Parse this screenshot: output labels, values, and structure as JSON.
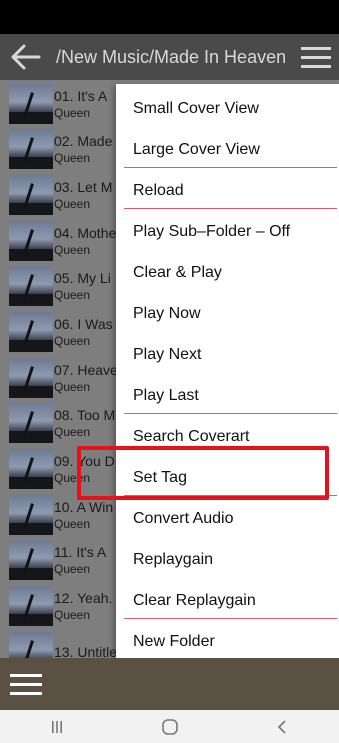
{
  "header": {
    "title": "/New Music/Made In Heaven"
  },
  "tracks": [
    {
      "title": "01. It's A",
      "artist": "Queen"
    },
    {
      "title": "02. Made",
      "artist": "Queen"
    },
    {
      "title": "03. Let M",
      "artist": "Queen"
    },
    {
      "title": "04. Mothe",
      "artist": "Queen"
    },
    {
      "title": "05. My Li",
      "artist": "Queen"
    },
    {
      "title": "06. I Was",
      "artist": "Queen"
    },
    {
      "title": "07. Heave",
      "artist": "Queen"
    },
    {
      "title": "08. Too M",
      "artist": "Queen"
    },
    {
      "title": "09. You D",
      "artist": "Queen"
    },
    {
      "title": "10. A Win",
      "artist": "Queen"
    },
    {
      "title": "11. It's A",
      "artist": "Queen"
    },
    {
      "title": "12. Yeah.",
      "artist": "Queen"
    },
    {
      "title": "13. Untitle",
      "artist": ""
    }
  ],
  "menu": {
    "items": [
      "Small Cover View",
      "Large Cover View",
      "Reload",
      "Play Sub–Folder – Off",
      "Clear & Play",
      "Play Now",
      "Play Next",
      "Play Last",
      "Search Coverart",
      "Set Tag",
      "Convert Audio",
      "Replaygain",
      "Clear Replaygain",
      "New Folder"
    ],
    "highlighted": "Set Tag"
  },
  "colors": {
    "highlight": "#e8101c",
    "separator": "#e35a6e",
    "top_bar": "#4a4a4a",
    "bottom_bar": "#5a5144"
  },
  "icons": {
    "back": "arrow-left-icon",
    "menu": "hamburger-menu-icon",
    "nav_recents": "recents-icon",
    "nav_home": "home-icon",
    "nav_back": "chevron-left-icon"
  }
}
